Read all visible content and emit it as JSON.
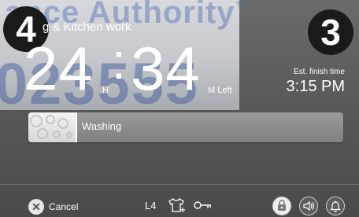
{
  "watermark": {
    "top_text": "ance Authority",
    "top_mark": "™",
    "big_text": "023555"
  },
  "badges": {
    "left": "4",
    "right": "3"
  },
  "program": {
    "name": "g & Kitchen work"
  },
  "timer": {
    "hours": "24",
    "minutes": "34",
    "hours_unit": "H",
    "minutes_unit": "M Left"
  },
  "finish": {
    "label": "Est. finish time",
    "time": "3:15 PM"
  },
  "progress": {
    "label": "Washing",
    "fraction": 0.15
  },
  "bottom_bar": {
    "cancel_label": "Cancel",
    "level": "L4"
  },
  "icons": {
    "cancel": "close-circle-icon",
    "shirt": "shirt-plus-icon",
    "key": "key-icon",
    "child_lock": "child-lock-icon",
    "sound": "sound-icon",
    "bell": "bell-icon"
  }
}
